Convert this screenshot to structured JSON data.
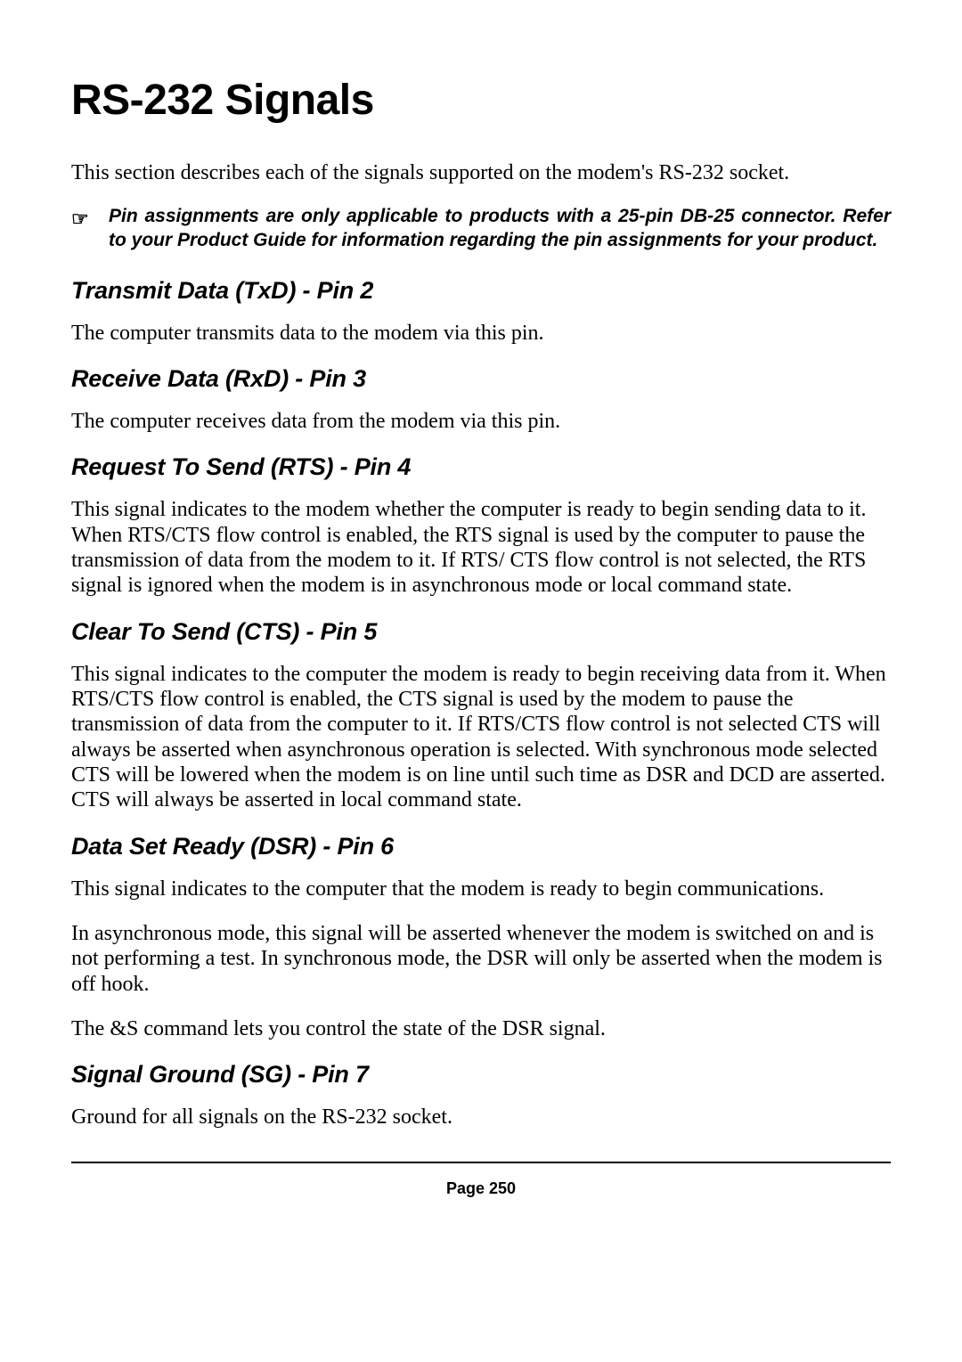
{
  "title": "RS-232 Signals",
  "intro": "This section describes each of the signals supported on the modem's RS-232 socket.",
  "note_icon": "☞",
  "note": "Pin assignments are only applicable to products with a 25-pin DB-25 connector. Refer to your Product Guide for information regarding the pin assignments for your product.",
  "sections": {
    "txd": {
      "heading": "Transmit Data (TxD) - Pin 2",
      "p1": "The computer transmits data to the modem via this pin."
    },
    "rxd": {
      "heading": "Receive Data (RxD) - Pin 3",
      "p1": "The computer receives data from the modem via this pin."
    },
    "rts": {
      "heading": "Request To Send (RTS) - Pin 4",
      "p1": "This signal indicates to the modem whether the computer is ready to begin sending data to it. When RTS/CTS flow control is enabled, the RTS signal is used by the computer to pause the transmission of data from the modem to it. If RTS/ CTS flow control is not selected, the RTS signal is ignored when the modem is in asynchronous mode or local command state."
    },
    "cts": {
      "heading": "Clear To Send (CTS) - Pin 5",
      "p1": "This signal indicates to the computer the modem is ready to begin receiving data from it. When RTS/CTS flow control is enabled, the CTS signal is used by the modem to pause the transmission of data from the computer to it. If RTS/CTS flow control is not selected CTS will always be asserted when asynchronous operation is selected. With synchronous mode selected CTS will be lowered when the modem is on line until such time as DSR and DCD are asserted. CTS will always be asserted in local command state."
    },
    "dsr": {
      "heading": "Data Set Ready (DSR) - Pin 6",
      "p1": "This signal indicates to the computer that the modem is ready to begin communications.",
      "p2": "In asynchronous mode, this signal will be asserted whenever the modem is switched on and is not performing a test. In synchronous mode, the DSR will only be asserted when the modem is off hook.",
      "p3": "The &S command lets you control the state of the DSR signal."
    },
    "sg": {
      "heading": "Signal Ground (SG) - Pin 7",
      "p1": "Ground for all signals on the RS-232 socket."
    }
  },
  "footer": "Page  250"
}
